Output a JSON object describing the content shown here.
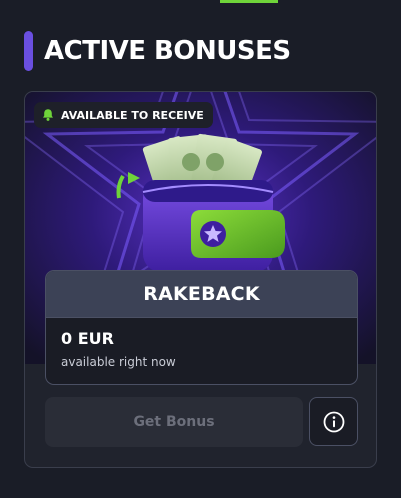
{
  "page": {
    "title": "ACTIVE BONUSES"
  },
  "card": {
    "badge": {
      "label": "AVAILABLE TO RECEIVE",
      "icon": "bell-icon"
    },
    "illustration": "wallet-with-cash-illustration",
    "panel": {
      "title": "RAKEBACK",
      "amount": "0 EUR",
      "amount_note": "available right now"
    },
    "actions": {
      "get_bonus_label": "Get Bonus",
      "info_icon": "info-icon"
    }
  },
  "colors": {
    "background": "#1a1d27",
    "accent_purple": "#6a4fe0",
    "accent_green": "#6fd43a",
    "panel_header": "#3c4256",
    "button_disabled": "#2a2d37"
  }
}
